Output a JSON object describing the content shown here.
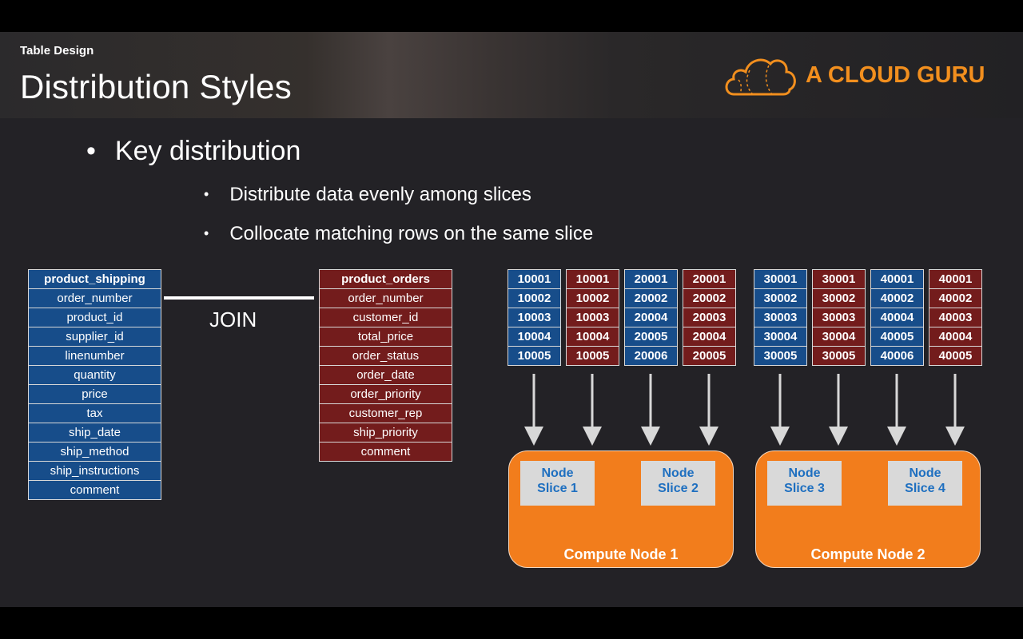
{
  "header": {
    "subtitle": "Table Design",
    "title": "Distribution Styles",
    "logo_text": "A CLOUD GURU",
    "brand_color": "#f28f1e"
  },
  "bullets": {
    "level1": "Key distribution",
    "level2": [
      "Distribute data evenly among slices",
      "Collocate matching rows on the same slice"
    ]
  },
  "tables": {
    "shipping": {
      "name": "product_shipping",
      "columns": [
        "order_number",
        "product_id",
        "supplier_id",
        "linenumber",
        "quantity",
        "price",
        "tax",
        "ship_date",
        "ship_method",
        "ship_instructions",
        "comment"
      ]
    },
    "orders": {
      "name": "product_orders",
      "columns": [
        "order_number",
        "customer_id",
        "total_price",
        "order_status",
        "order_date",
        "order_priority",
        "customer_rep",
        "ship_priority",
        "comment"
      ]
    }
  },
  "join_label": "JOIN",
  "slice_columns": [
    {
      "table": "blue",
      "values": [
        "10001",
        "10002",
        "10003",
        "10004",
        "10005"
      ]
    },
    {
      "table": "red",
      "values": [
        "10001",
        "10002",
        "10003",
        "10004",
        "10005"
      ]
    },
    {
      "table": "blue",
      "values": [
        "20001",
        "20002",
        "20004",
        "20005",
        "20006"
      ]
    },
    {
      "table": "red",
      "values": [
        "20001",
        "20002",
        "20003",
        "20004",
        "20005"
      ]
    },
    {
      "table": "blue",
      "values": [
        "30001",
        "30002",
        "30003",
        "30004",
        "30005"
      ]
    },
    {
      "table": "red",
      "values": [
        "30001",
        "30002",
        "30003",
        "30004",
        "30005"
      ]
    },
    {
      "table": "blue",
      "values": [
        "40001",
        "40002",
        "40004",
        "40005",
        "40006"
      ]
    },
    {
      "table": "red",
      "values": [
        "40001",
        "40002",
        "40003",
        "40004",
        "40005"
      ]
    }
  ],
  "nodes": [
    {
      "label": "Compute Node 1",
      "slices": [
        [
          "Node",
          "Slice 1"
        ],
        [
          "Node",
          "Slice 2"
        ]
      ]
    },
    {
      "label": "Compute Node 2",
      "slices": [
        [
          "Node",
          "Slice 3"
        ],
        [
          "Node",
          "Slice 4"
        ]
      ]
    }
  ],
  "colors": {
    "shipping": "#174d8a",
    "orders": "#731c1c",
    "node": "#f27d1c",
    "slice_text": "#1e6fc0"
  }
}
